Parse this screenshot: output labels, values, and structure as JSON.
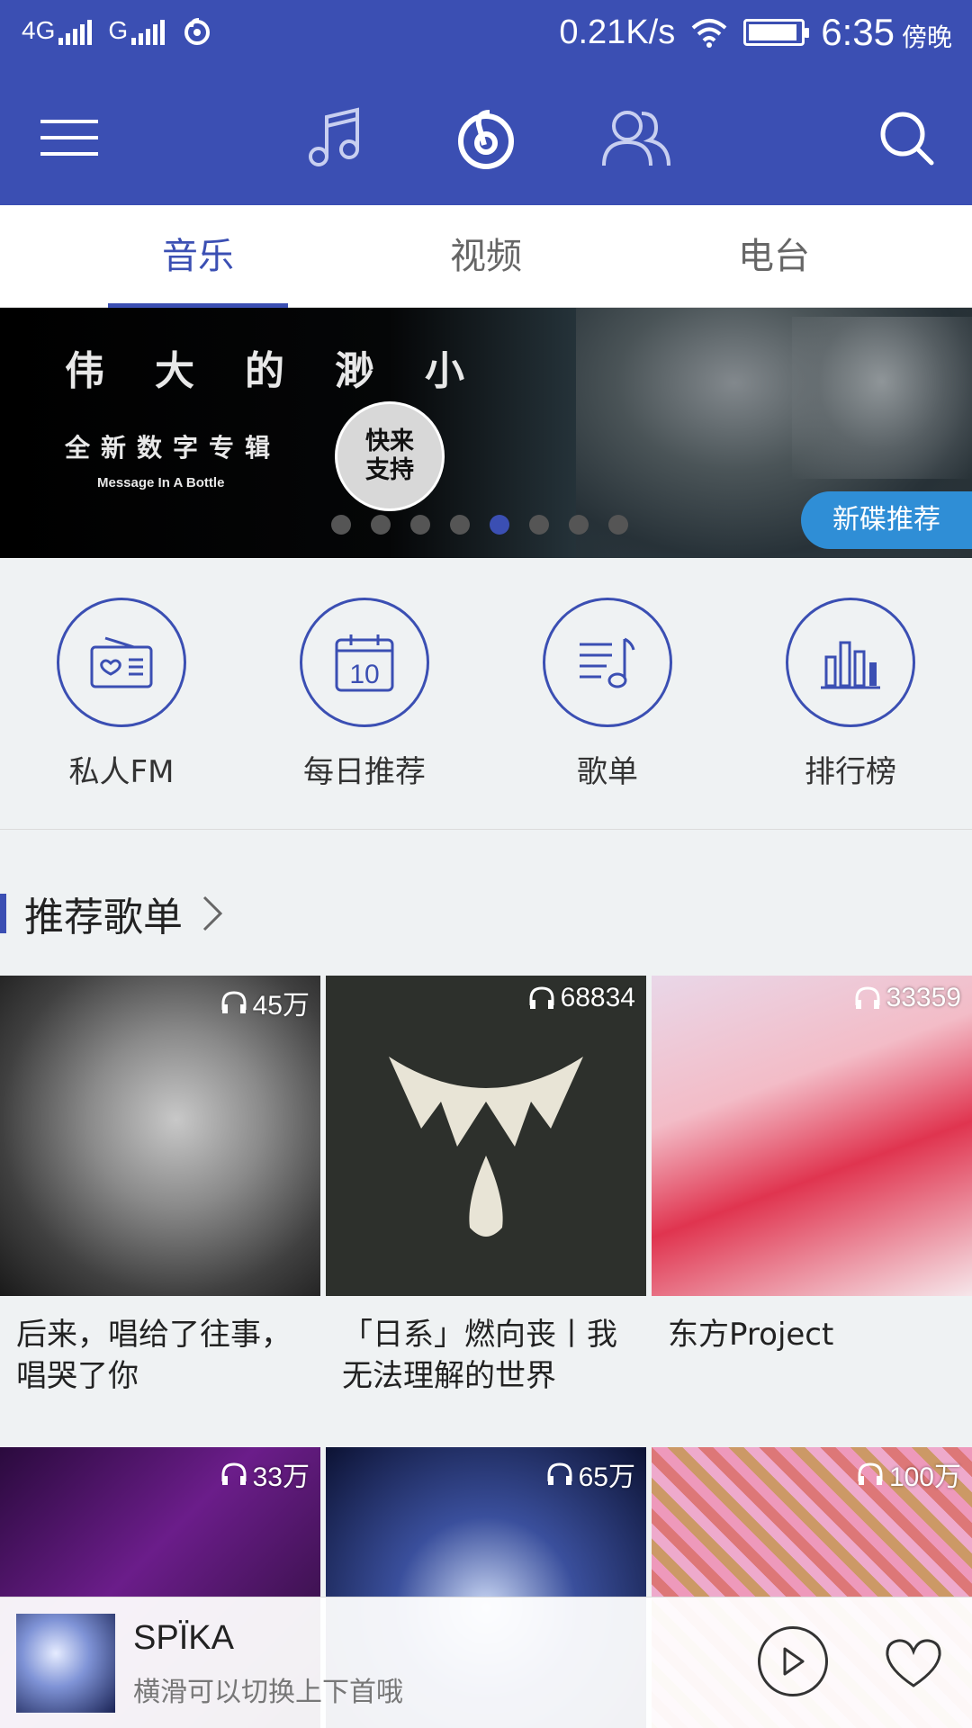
{
  "status": {
    "net1": "4G",
    "net2": "G",
    "speed": "0.21K/s",
    "time": "6:35",
    "period": "傍晚",
    "battery_level": 0.95
  },
  "nav": {
    "menu_icon": "menu-icon",
    "music_icon": "music-note-icon",
    "netease_icon": "netease-logo-icon",
    "friends_icon": "friends-icon",
    "search_icon": "search-icon"
  },
  "tabs": [
    {
      "label": "音乐",
      "active": true
    },
    {
      "label": "视频",
      "active": false
    },
    {
      "label": "电台",
      "active": false
    }
  ],
  "banner": {
    "title": "伟大的渺小",
    "subtitle": "全新数字专辑",
    "subtitle_en": "Message In A Bottle",
    "badge_line1": "快来",
    "badge_line2": "支持",
    "tag": "新碟推荐",
    "dot_count": 8,
    "active_dot": 5
  },
  "quick": [
    {
      "label": "私人FM",
      "icon": "radio-heart-icon"
    },
    {
      "label": "每日推荐",
      "icon": "calendar-icon",
      "day": "10"
    },
    {
      "label": "歌单",
      "icon": "playlist-icon"
    },
    {
      "label": "排行榜",
      "icon": "chart-bars-icon"
    }
  ],
  "recommend": {
    "title": "推荐歌单",
    "items": [
      {
        "plays": "45万",
        "name": "后来，唱给了往事，唱哭了你"
      },
      {
        "plays": "68834",
        "name": "「日系」燃向丧丨我无法理解的世界"
      },
      {
        "plays": "33359",
        "name": "东方Project"
      },
      {
        "plays": "33万",
        "name": ""
      },
      {
        "plays": "65万",
        "name": ""
      },
      {
        "plays": "100万",
        "name": ""
      }
    ]
  },
  "player": {
    "title": "SPÏKA",
    "hint": "横滑可以切换上下首哦"
  },
  "colors": {
    "primary": "#3b4fb3",
    "tag": "#2f8ed6"
  }
}
